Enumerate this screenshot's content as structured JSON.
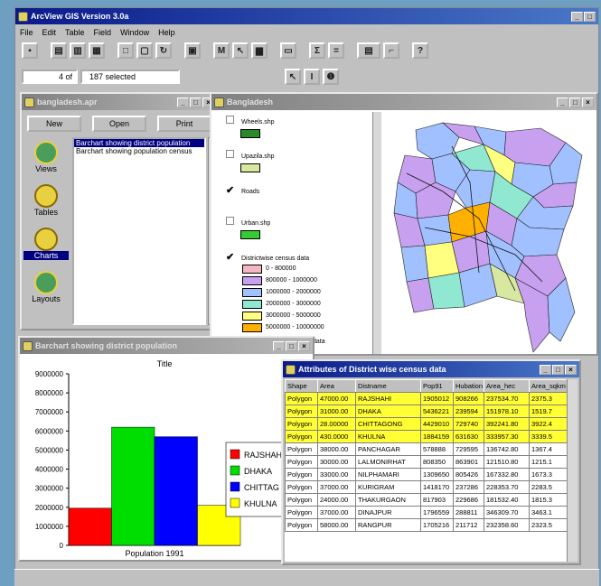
{
  "app": {
    "title": "ArcView GIS Version 3.0a"
  },
  "menu": [
    "File",
    "Edit",
    "Table",
    "Field",
    "Window",
    "Help"
  ],
  "status": {
    "count": "4",
    "of": "of",
    "selected": "187 selected"
  },
  "project": {
    "title": "bangladesh.apr",
    "new": "New",
    "open": "Open",
    "print": "Print",
    "icons": [
      "Views",
      "Tables",
      "Charts",
      "Layouts"
    ],
    "items": [
      "Barchart showing district population",
      "Barchart showing population census"
    ]
  },
  "view": {
    "title": "Bangladesh",
    "layers": [
      {
        "name": "Wheels.shp",
        "color": "#2a8a2a",
        "checked": false
      },
      {
        "name": "Upazila.shp",
        "color": "#d8e8a0",
        "checked": false
      },
      {
        "name": "Roads",
        "checked": true
      },
      {
        "name": "Urban.shp",
        "color": "#33cc33",
        "checked": false
      }
    ],
    "census": {
      "name": "Districtwise census data",
      "checked": true,
      "classes": [
        {
          "label": "0 - 800000",
          "color": "#f4b6c2"
        },
        {
          "label": "800000 - 1000000",
          "color": "#c8a0f0"
        },
        {
          "label": "1000000 - 2000000",
          "color": "#a0c0ff"
        },
        {
          "label": "2000000 - 3000000",
          "color": "#90e8d0"
        },
        {
          "label": "3000000 - 5000000",
          "color": "#ffff80"
        },
        {
          "label": "5000000 - 10000000",
          "color": "#ffb000"
        }
      ]
    },
    "extra": "data"
  },
  "chart": {
    "title": "Barchart showing district population",
    "xlabel": "Population 1991"
  },
  "chart_data": {
    "type": "bar",
    "title": "Title",
    "categories": [
      "RAJSHAHI",
      "DHAKA",
      "CHITTAGONG",
      "KHULNA"
    ],
    "legend": [
      "RAJSHAH",
      "DHAKA",
      "CHITTAG",
      "KHULNA"
    ],
    "values": [
      1950000,
      6200000,
      5700000,
      2100000
    ],
    "colors": [
      "#ff0000",
      "#00dd00",
      "#0000ff",
      "#ffff00"
    ],
    "xlabel": "Population 1991",
    "ylim": [
      0,
      9000000
    ],
    "yticks": [
      "9000000",
      "8000000",
      "7000000",
      "6000000",
      "5000000",
      "4000000",
      "3000000",
      "2000000",
      "1000000",
      "0"
    ]
  },
  "table": {
    "title": "Attributes of District wise census data",
    "columns": [
      "Shape",
      "Area",
      "Distname",
      "Pop91",
      "Hubation",
      "Area_hec",
      "Area_sqkm"
    ],
    "rows": [
      [
        "Polygon",
        "47000.00",
        "RAJSHAHI",
        "1905012",
        "908266",
        "237534.70",
        "2375.3"
      ],
      [
        "Polygon",
        "31000.00",
        "DHAKA",
        "5436221",
        "239594",
        "151978.10",
        "1519.7"
      ],
      [
        "Polygon",
        "28.00000",
        "CHITTAGONG",
        "4429010",
        "729740",
        "392241.80",
        "3922.4"
      ],
      [
        "Polygon",
        "430.0000",
        "KHULNA",
        "1884159",
        "631630",
        "333957.30",
        "3339.5"
      ],
      [
        "Polygon",
        "38000.00",
        "PANCHAGAR",
        "578888",
        "729595",
        "136742.80",
        "1367.4"
      ],
      [
        "Polygon",
        "30000.00",
        "LALMONIRHAT",
        "808350",
        "863901",
        "121510.80",
        "1215.1"
      ],
      [
        "Polygon",
        "33000.00",
        "NILPHAMARI",
        "1309650",
        "805426",
        "167332.80",
        "1673.3"
      ],
      [
        "Polygon",
        "37000.00",
        "KURIGRAM",
        "1418170",
        "237286",
        "228353.70",
        "2283.5"
      ],
      [
        "Polygon",
        "24000.00",
        "THAKURGAON",
        "817903",
        "229686",
        "181532.40",
        "1815.3"
      ],
      [
        "Polygon",
        "37000.00",
        "DINAJPUR",
        "1796559",
        "288811",
        "346309.70",
        "3463.1"
      ],
      [
        "Polygon",
        "58000.00",
        "RANGPUR",
        "1705216",
        "211712",
        "232358.60",
        "2323.5"
      ]
    ],
    "selected": 4
  }
}
